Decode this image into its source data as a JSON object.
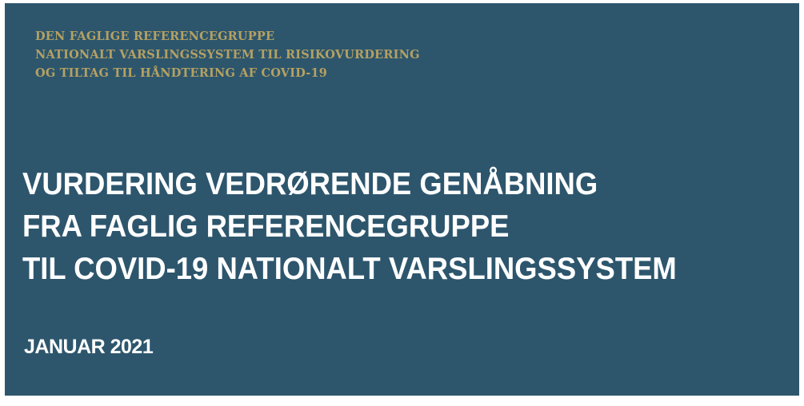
{
  "header": {
    "lines": [
      "DEN FAGLIGE REFERENCEGRUPPE",
      "NATIONALT VARSLINGSSYSTEM TIL RISIKOVURDERING",
      "OG TILTAG TIL HÅNDTERING AF COVID-19"
    ]
  },
  "title": {
    "lines": [
      "VURDERING VEDRØRENDE GENÅBNING",
      "FRA FAGLIG REFERENCEGRUPPE",
      "TIL COVID-19 NATIONALT VARSLINGSSYSTEM"
    ]
  },
  "date": "JANUAR 2021",
  "colors": {
    "background": "#2d566d",
    "header_text": "#b5a162",
    "title_text": "#ffffff"
  }
}
